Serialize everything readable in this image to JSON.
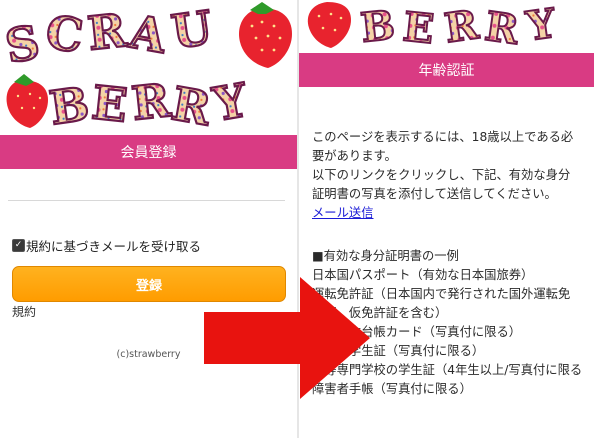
{
  "left": {
    "logo_text": "SCRUBBERRY",
    "signup_title": "会員登録",
    "checkbox_label": "規約に基づきメールを受け取る",
    "register_button": "登録",
    "terms_link": "規約",
    "copyright": "(c)strawberry"
  },
  "right": {
    "age_title": "年齢認証",
    "intro_line1": "このページを表示するには、18歳以上である必",
    "intro_line2": "要があります。",
    "intro_line3": "以下のリンクをクリックし、下記、有効な身分",
    "intro_line4": "証明書の写真を添付して送信してください。",
    "mail_link": "メール送信",
    "id_heading": "■有効な身分証明書の一例",
    "id_items": [
      "日本国パスポート（有効な日本国旅券）",
      "運転免許証（日本国内で発行された国外運転免",
      "許証、仮免許証を含む）",
      "住民基本台帳カード（写真付に限る）",
      "大学の学生証（写真付に限る）",
      "高等専門学校の学生証（4年生以上/写真付に限る",
      "障害者手帳（写真付に限る）"
    ]
  },
  "colors": {
    "pink_bar": "#d93b83",
    "button_orange": "#ff9c00",
    "arrow_red": "#e8130f",
    "link_blue": "#1a1ad6"
  }
}
